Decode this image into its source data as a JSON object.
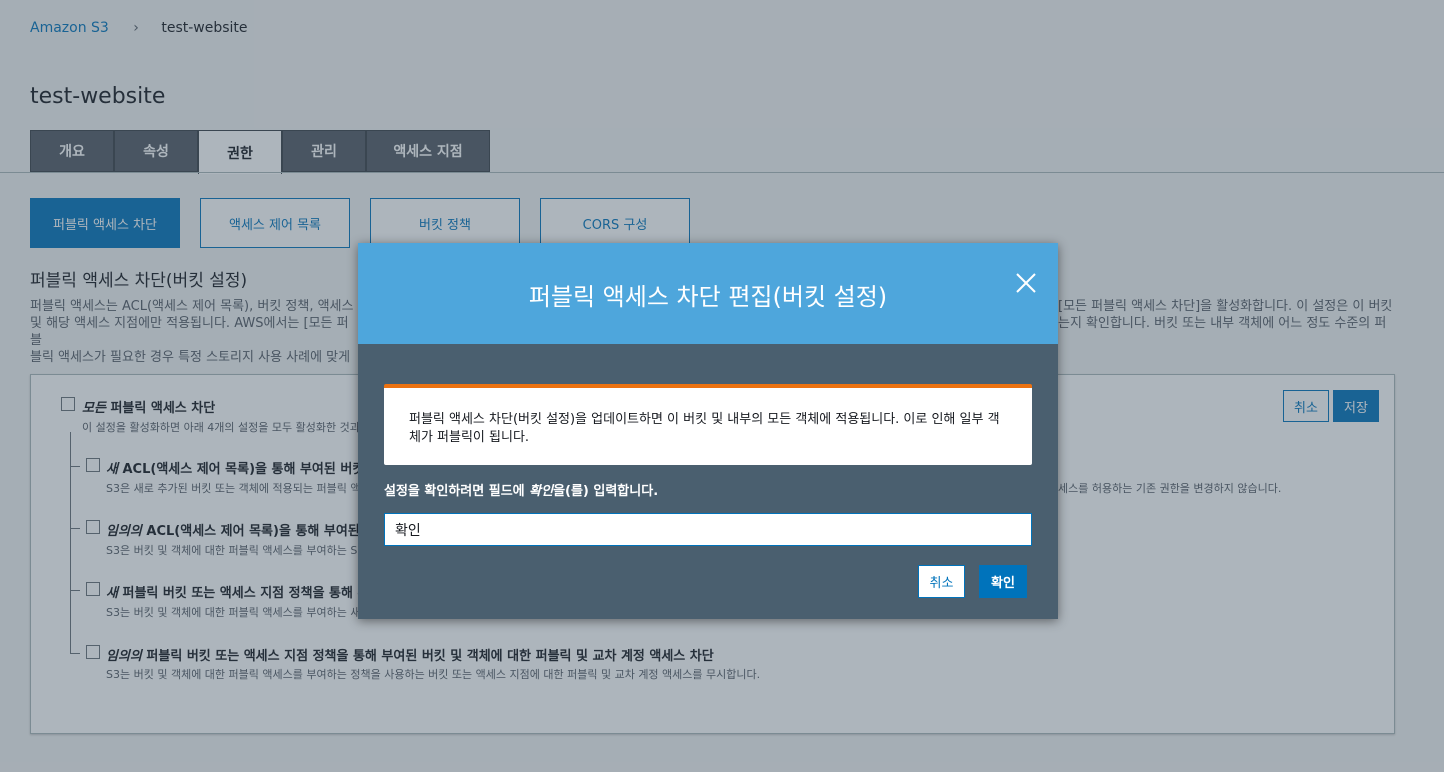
{
  "breadcrumb": {
    "root": "Amazon S3",
    "separator": "›",
    "current": "test-website"
  },
  "page_title": "test-website",
  "tabs": [
    {
      "label": "개요"
    },
    {
      "label": "속성"
    },
    {
      "label": "권한",
      "active": true
    },
    {
      "label": "관리"
    },
    {
      "label": "액세스 지점"
    }
  ],
  "subtabs": [
    {
      "label": "퍼블릭 액세스 차단",
      "active": true
    },
    {
      "label": "액세스 제어 목록"
    },
    {
      "label": "버킷 정책"
    },
    {
      "label": "CORS 구성"
    }
  ],
  "section": {
    "title": "퍼블릭 액세스 차단(버킷 설정)",
    "desc_left": [
      "퍼블릭 액세스는 ACL(액세스 제어 목록), 버킷 정책, 액세스",
      "및 해당 액세스 지점에만 적용됩니다. AWS에서는 [모든 퍼블",
      "블릭 액세스가 필요한 경우 특정 스토리지 사용 사례에 맞게"
    ],
    "desc_right": [
      "[모든 퍼블릭 액세스 차단]을 활성화합니다. 이 설정은 이 버킷",
      "는지 확인합니다. 버킷 또는 내부 객체에 어느 정도 수준의 퍼",
      ""
    ]
  },
  "panel": {
    "cancel_label": "취소",
    "save_label": "저장",
    "block_all": {
      "label_em": "모든",
      "label": " 퍼블릭 액세스 차단",
      "desc": "이 설정을 활성화하면 아래 4개의 설정을 모두 활성화한 것과"
    },
    "options": [
      {
        "em": "새",
        "label": " ACL(액세스 제어 목록)을 통해 부여된 버킷",
        "desc": "S3은 새로 추가된 버킷 또는 객체에 적용되는 퍼블릭 액",
        "desc_right": "세스를 허용하는 기존 권한을 변경하지 않습니다."
      },
      {
        "em": "임의의",
        "label": " ACL(액세스 제어 목록)을 통해 부여된",
        "desc": "S3은 버킷 및 객체에 대한 퍼블릭 액세스를 부여하는 S",
        "desc_right": ""
      },
      {
        "em": "새",
        "label": " 퍼블릭 버킷 또는 액세스 지점 정책을 통해 부",
        "desc": "S3는 버킷 및 객체에 대한 퍼블릭 액세스를 부여하는 새",
        "desc_right": ""
      },
      {
        "em": "임의의",
        "label": " 퍼블릭 버킷 또는 액세스 지점 정책을 통해 부여된 버킷 및 객체에 대한 퍼블릭 및 교차 계정 액세스 차단",
        "desc": "S3는 버킷 및 객체에 대한 퍼블릭 액세스를 부여하는 정책을 사용하는 버킷 또는 액세스 지점에 대한 퍼블릭 및 교차 계정 액세스를 무시합니다.",
        "desc_right": ""
      }
    ]
  },
  "modal": {
    "title": "퍼블릭 액세스 차단 편집(버킷 설정)",
    "close_icon": "close-icon",
    "alert_text": "퍼블릭 액세스 차단(버킷 설정)을 업데이트하면 이 버킷 및 내부의 모든 객체에 적용됩니다. 이로 인해 일부 객체가 퍼블릭이 됩니다.",
    "prompt_prefix": "설정을 확인하려면 필드에 ",
    "prompt_em": "확인",
    "prompt_suffix": "을(를) 입력합니다.",
    "input_value": "확인",
    "cancel_label": "취소",
    "confirm_label": "확인"
  },
  "colors": {
    "primary": "#0073bb",
    "modal_header": "#4ea6dc",
    "modal_body": "#4a5f6f",
    "alert_border": "#ec7211",
    "tab_bg": "#545b64"
  }
}
